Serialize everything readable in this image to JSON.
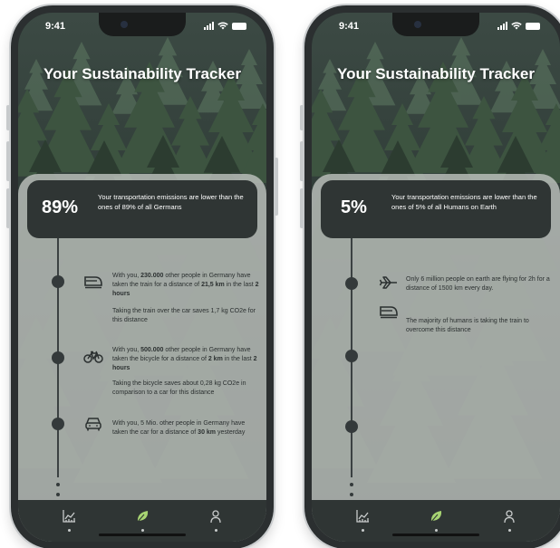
{
  "phones": [
    {
      "status_time": "9:41",
      "app_title": "Your Sustainability Tracker",
      "card": {
        "percent": "89%",
        "text": "Your transportation emissions are lower than the ones of 89% of all Germans"
      },
      "entries": [
        {
          "icon": "train-icon",
          "parts": [
            "With you, ",
            "230.000",
            " other people in Germany have taken the train for a distance of ",
            "21,5 km",
            " in the last ",
            "2 hours",
            ""
          ]
        },
        {
          "icon": null,
          "parts": [
            "Taking the train over the car saves 1,7 kg CO2e for this distance"
          ]
        },
        {
          "icon": "bicycle-icon",
          "parts": [
            "With you, ",
            "500.000",
            " other people in Germany have taken the bicycle for a distance of ",
            "2 km",
            " in the last ",
            "2 hours",
            ""
          ]
        },
        {
          "icon": null,
          "parts": [
            "Taking the bicycle saves about 0,28 kg CO2e in comparison to a car for this distance"
          ]
        },
        {
          "icon": "car-icon",
          "parts": [
            "With you, 5 Mio. other people in Germany have taken the car for a distance of ",
            " 30 km",
            " yesterday"
          ]
        }
      ]
    },
    {
      "status_time": "9:41",
      "app_title": "Your Sustainability Tracker",
      "card": {
        "percent": "5%",
        "text": "Your transportation emissions are lower than the ones of 5% of all Humans on Earth"
      },
      "entries": [
        {
          "icon": "airplane-icon",
          "parts": [
            "Only 6 million people on earth are flying for 2h for a distance of 1500 km every day."
          ]
        },
        {
          "icon": "train-icon",
          "parts": [
            "The majority of humans is taking the train to overcome this distance"
          ]
        }
      ]
    }
  ],
  "tabs": [
    {
      "icon": "statistics-icon"
    },
    {
      "icon": "leaf-icon",
      "accent": "#a7d472"
    },
    {
      "icon": "profile-icon"
    }
  ],
  "colors": {
    "card": "#2f3534",
    "panel": "#c4c8c4",
    "leaf_accent": "#a7d472",
    "forest_dark": "#24302c"
  }
}
